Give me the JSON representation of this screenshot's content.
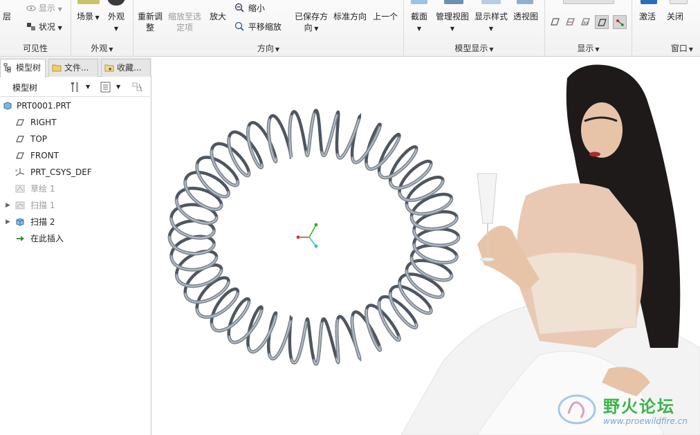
{
  "ribbon": {
    "layer_label": "层",
    "display_label": "显示",
    "status_label": "状况",
    "visibility_group": "可见性",
    "scene_label": "场景",
    "appearance_label": "外观",
    "appearance_group": "外观",
    "reorient_label_1": "重新调",
    "reorient_label_2": "整",
    "zoom_selected_label_1": "缩放至选",
    "zoom_selected_label_2": "定项",
    "zoom_in_label": "放大",
    "zoom_out_label": "缩小",
    "pan_zoom_label": "平移缩放",
    "saved_orient_label_1": "已保存方",
    "saved_orient_label_2": "向",
    "standard_orient_label": "标准方向",
    "previous_label": "上一个",
    "orientation_group": "方向",
    "section_label": "截面",
    "manage_views_label": "管理视图",
    "display_style_label": "显示样式",
    "perspective_label": "透视图",
    "model_display_group": "模型显示",
    "show_group": "显示",
    "activate_label": "激活",
    "close_label": "关闭",
    "window_group": "窗口"
  },
  "panel": {
    "tabs": [
      {
        "label": "模型树"
      },
      {
        "label": "文件..."
      },
      {
        "label": "收藏..."
      }
    ],
    "tree_title": "模型树",
    "items": [
      {
        "label": "PRT0001.PRT",
        "icon": "part-icon"
      },
      {
        "label": "RIGHT",
        "icon": "datum-plane-icon"
      },
      {
        "label": "TOP",
        "icon": "datum-plane-icon"
      },
      {
        "label": "FRONT",
        "icon": "datum-plane-icon"
      },
      {
        "label": "PRT_CSYS_DEF",
        "icon": "csys-icon"
      },
      {
        "label": "草绘 1",
        "icon": "sketch-icon"
      },
      {
        "label": "扫描 1",
        "icon": "sweep-icon"
      },
      {
        "label": "扫描 2",
        "icon": "sweep-icon"
      },
      {
        "label": "在此插入",
        "icon": "insert-here-icon"
      }
    ]
  },
  "watermark": {
    "title": "野火论坛",
    "url": "www.proewildfire.cn"
  },
  "colors": {
    "spring": "#7f8893",
    "spring_dark": "#4e5660",
    "axis_x": "#e03030",
    "axis_y": "#30b030",
    "axis_z": "#30c0d0",
    "accent": "#2a6fb5"
  }
}
